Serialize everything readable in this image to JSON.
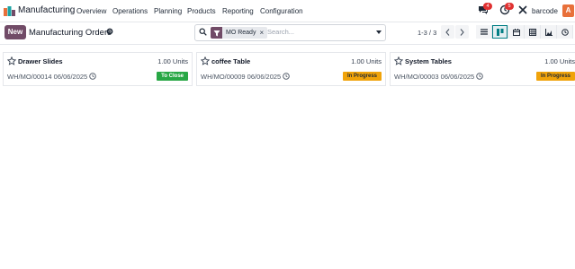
{
  "app": {
    "name": "Manufacturing"
  },
  "menu": [
    "Overview",
    "Operations",
    "Planning",
    "Products",
    "Reporting",
    "Configuration"
  ],
  "systray": {
    "messages_count": "4",
    "activities_count": "5",
    "company": "barcode",
    "user_initial": "A"
  },
  "control": {
    "new_label": "New",
    "title": "Manufacturing Orders",
    "facet_label": "MO Ready",
    "search_placeholder": "Search...",
    "pager": "1-3 / 3"
  },
  "cards": [
    {
      "name": "Drawer Slides",
      "qty": "1.00 Units",
      "ref": "WH/MO/00014 06/06/2025",
      "status": "To Close",
      "status_color": "#28a745",
      "status_text_color": "#ffffff"
    },
    {
      "name": "coffee Table",
      "qty": "1.00 Units",
      "ref": "WH/MO/00009 06/06/2025",
      "status": "In Progress",
      "status_color": "#f0a30a",
      "status_text_color": "#1f2937"
    },
    {
      "name": "System Tables",
      "qty": "1.00 Units",
      "ref": "WH/MO/00003 06/06/2025",
      "status": "In Progress",
      "status_color": "#f0a30a",
      "status_text_color": "#1f2937"
    }
  ],
  "colors": {
    "brand": "#714b67",
    "accent": "#017e84",
    "badge": "#e03131"
  },
  "icons": [
    "manufacturing-logo-icon",
    "chat-icon",
    "activity-clock-icon",
    "tools-icon",
    "gear-icon",
    "search-icon",
    "filter-icon",
    "close-icon",
    "caret-down-icon",
    "chevron-left-icon",
    "chevron-right-icon",
    "list-view-icon",
    "kanban-view-icon",
    "calendar-view-icon",
    "pivot-view-icon",
    "graph-view-icon",
    "activity-view-icon",
    "star-icon",
    "clock-icon"
  ]
}
